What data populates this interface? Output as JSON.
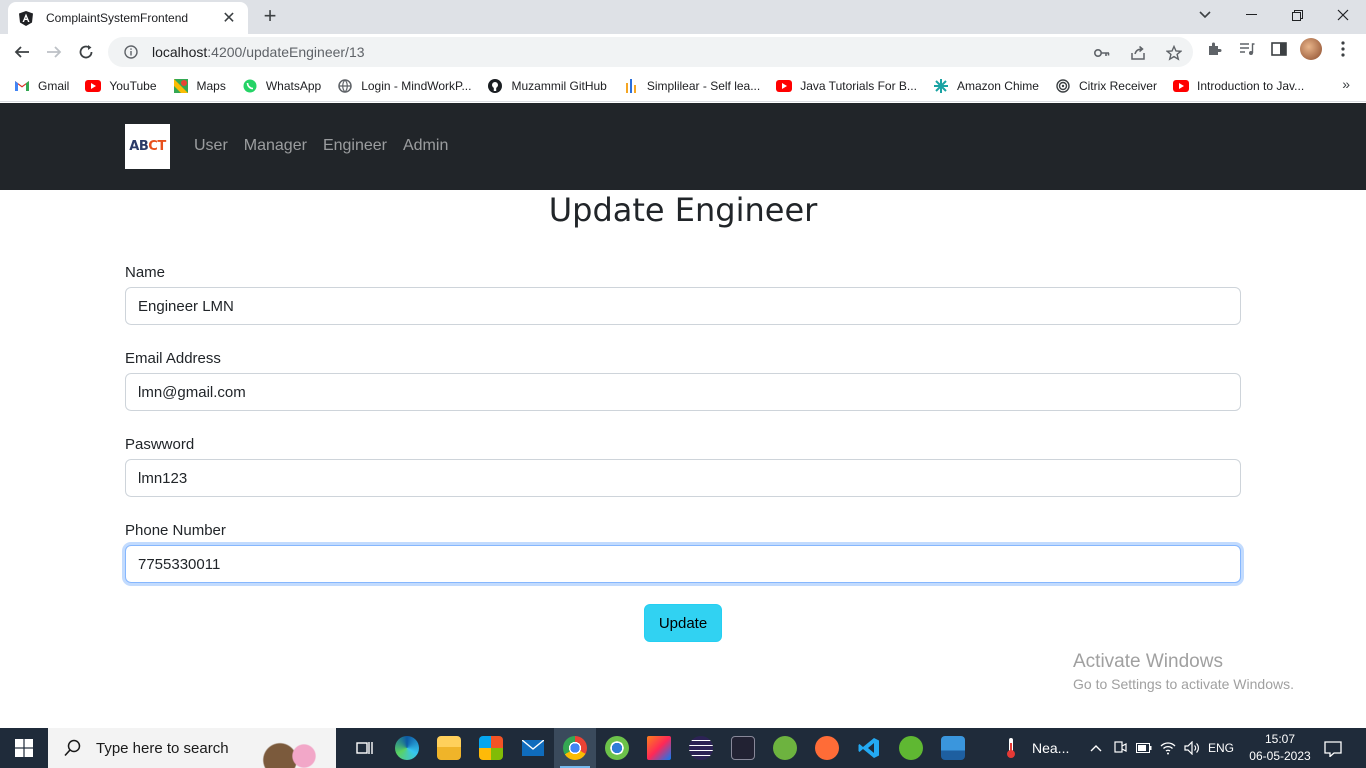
{
  "browser": {
    "tab_title": "ComplaintSystemFrontend",
    "tab_close": "✕",
    "new_tab": "+",
    "url_host": "localhost",
    "url_path": ":4200/updateEngineer/13",
    "bookmarks": [
      {
        "label": "Gmail",
        "icon": "gmail-icon"
      },
      {
        "label": "YouTube",
        "icon": "youtube-icon"
      },
      {
        "label": "Maps",
        "icon": "maps-icon"
      },
      {
        "label": "WhatsApp",
        "icon": "whatsapp-icon"
      },
      {
        "label": "Login - MindWorkP...",
        "icon": "globe-icon"
      },
      {
        "label": "Muzammil GitHub",
        "icon": "github-icon"
      },
      {
        "label": "Simplilear - Self lea...",
        "icon": "simplilearn-icon"
      },
      {
        "label": "Java Tutorials For B...",
        "icon": "youtube-icon"
      },
      {
        "label": "Amazon Chime",
        "icon": "chime-icon"
      },
      {
        "label": "Citrix Receiver",
        "icon": "citrix-icon"
      },
      {
        "label": "Introduction to Jav...",
        "icon": "youtube-icon"
      }
    ],
    "bookmarks_more": "»"
  },
  "navbar": {
    "brand": "ABCT",
    "links": [
      "User",
      "Manager",
      "Engineer",
      "Admin"
    ]
  },
  "form": {
    "title": "Update Engineer",
    "name_label": "Name",
    "name_value": "Engineer LMN",
    "email_label": "Email Address",
    "email_value": "lmn@gmail.com",
    "password_label": "Paswword",
    "password_value": "lmn123",
    "phone_label": "Phone Number",
    "phone_value": "7755330011",
    "submit_label": "Update"
  },
  "watermark": {
    "line1": "Activate Windows",
    "line2": "Go to Settings to activate Windows."
  },
  "taskbar": {
    "search_placeholder": "Type here to search",
    "weather": "Nea...",
    "language": "ENG",
    "time": "15:07",
    "date": "06-05-2023"
  },
  "colors": {
    "navbar_bg": "#212529",
    "button_info": "#31d2f2",
    "taskbar_bg": "#1f2b3a"
  }
}
